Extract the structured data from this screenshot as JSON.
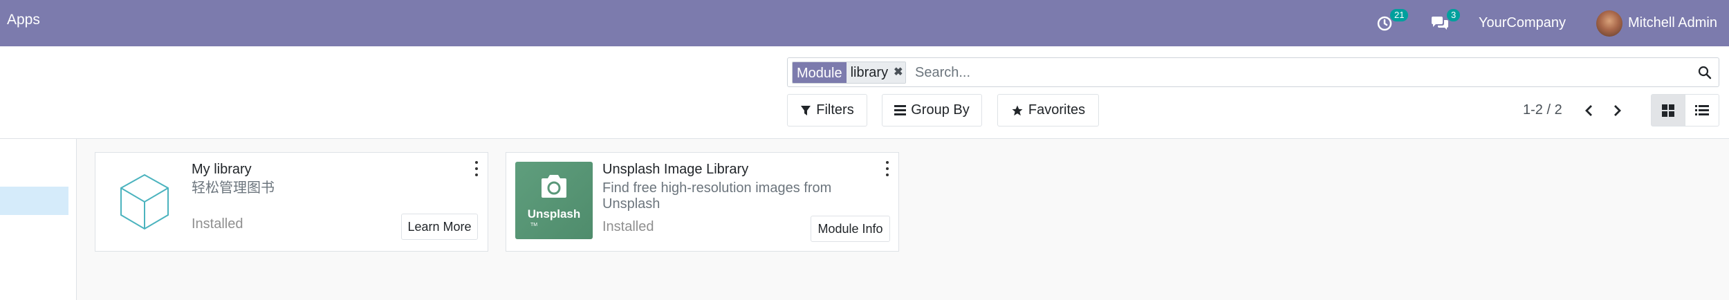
{
  "navbar": {
    "title": "Apps",
    "activity_count": "21",
    "messages_count": "3",
    "company": "YourCompany",
    "user": "Mitchell Admin"
  },
  "search": {
    "facet_label": "Module",
    "facet_value": "library",
    "placeholder": "Search..."
  },
  "toolbar": {
    "filters_label": "Filters",
    "group_by_label": "Group By",
    "favorites_label": "Favorites",
    "pager": "1-2 / 2"
  },
  "cards": [
    {
      "title": "My library",
      "subtitle": "轻松管理图书",
      "status": "Installed",
      "button": "Learn More",
      "icon": "cube-icon"
    },
    {
      "title": "Unsplash Image Library",
      "subtitle_line1": "Find free high-resolution images from",
      "subtitle_line2": "Unsplash",
      "status": "Installed",
      "button": "Module Info",
      "thumb_text": "Unsplash",
      "thumb_tm": "TM",
      "icon": "camera-icon"
    }
  ],
  "colors": {
    "navbar": "#7c7bad",
    "badge": "#00a09d",
    "sidebar_active": "#d5ebfa"
  }
}
